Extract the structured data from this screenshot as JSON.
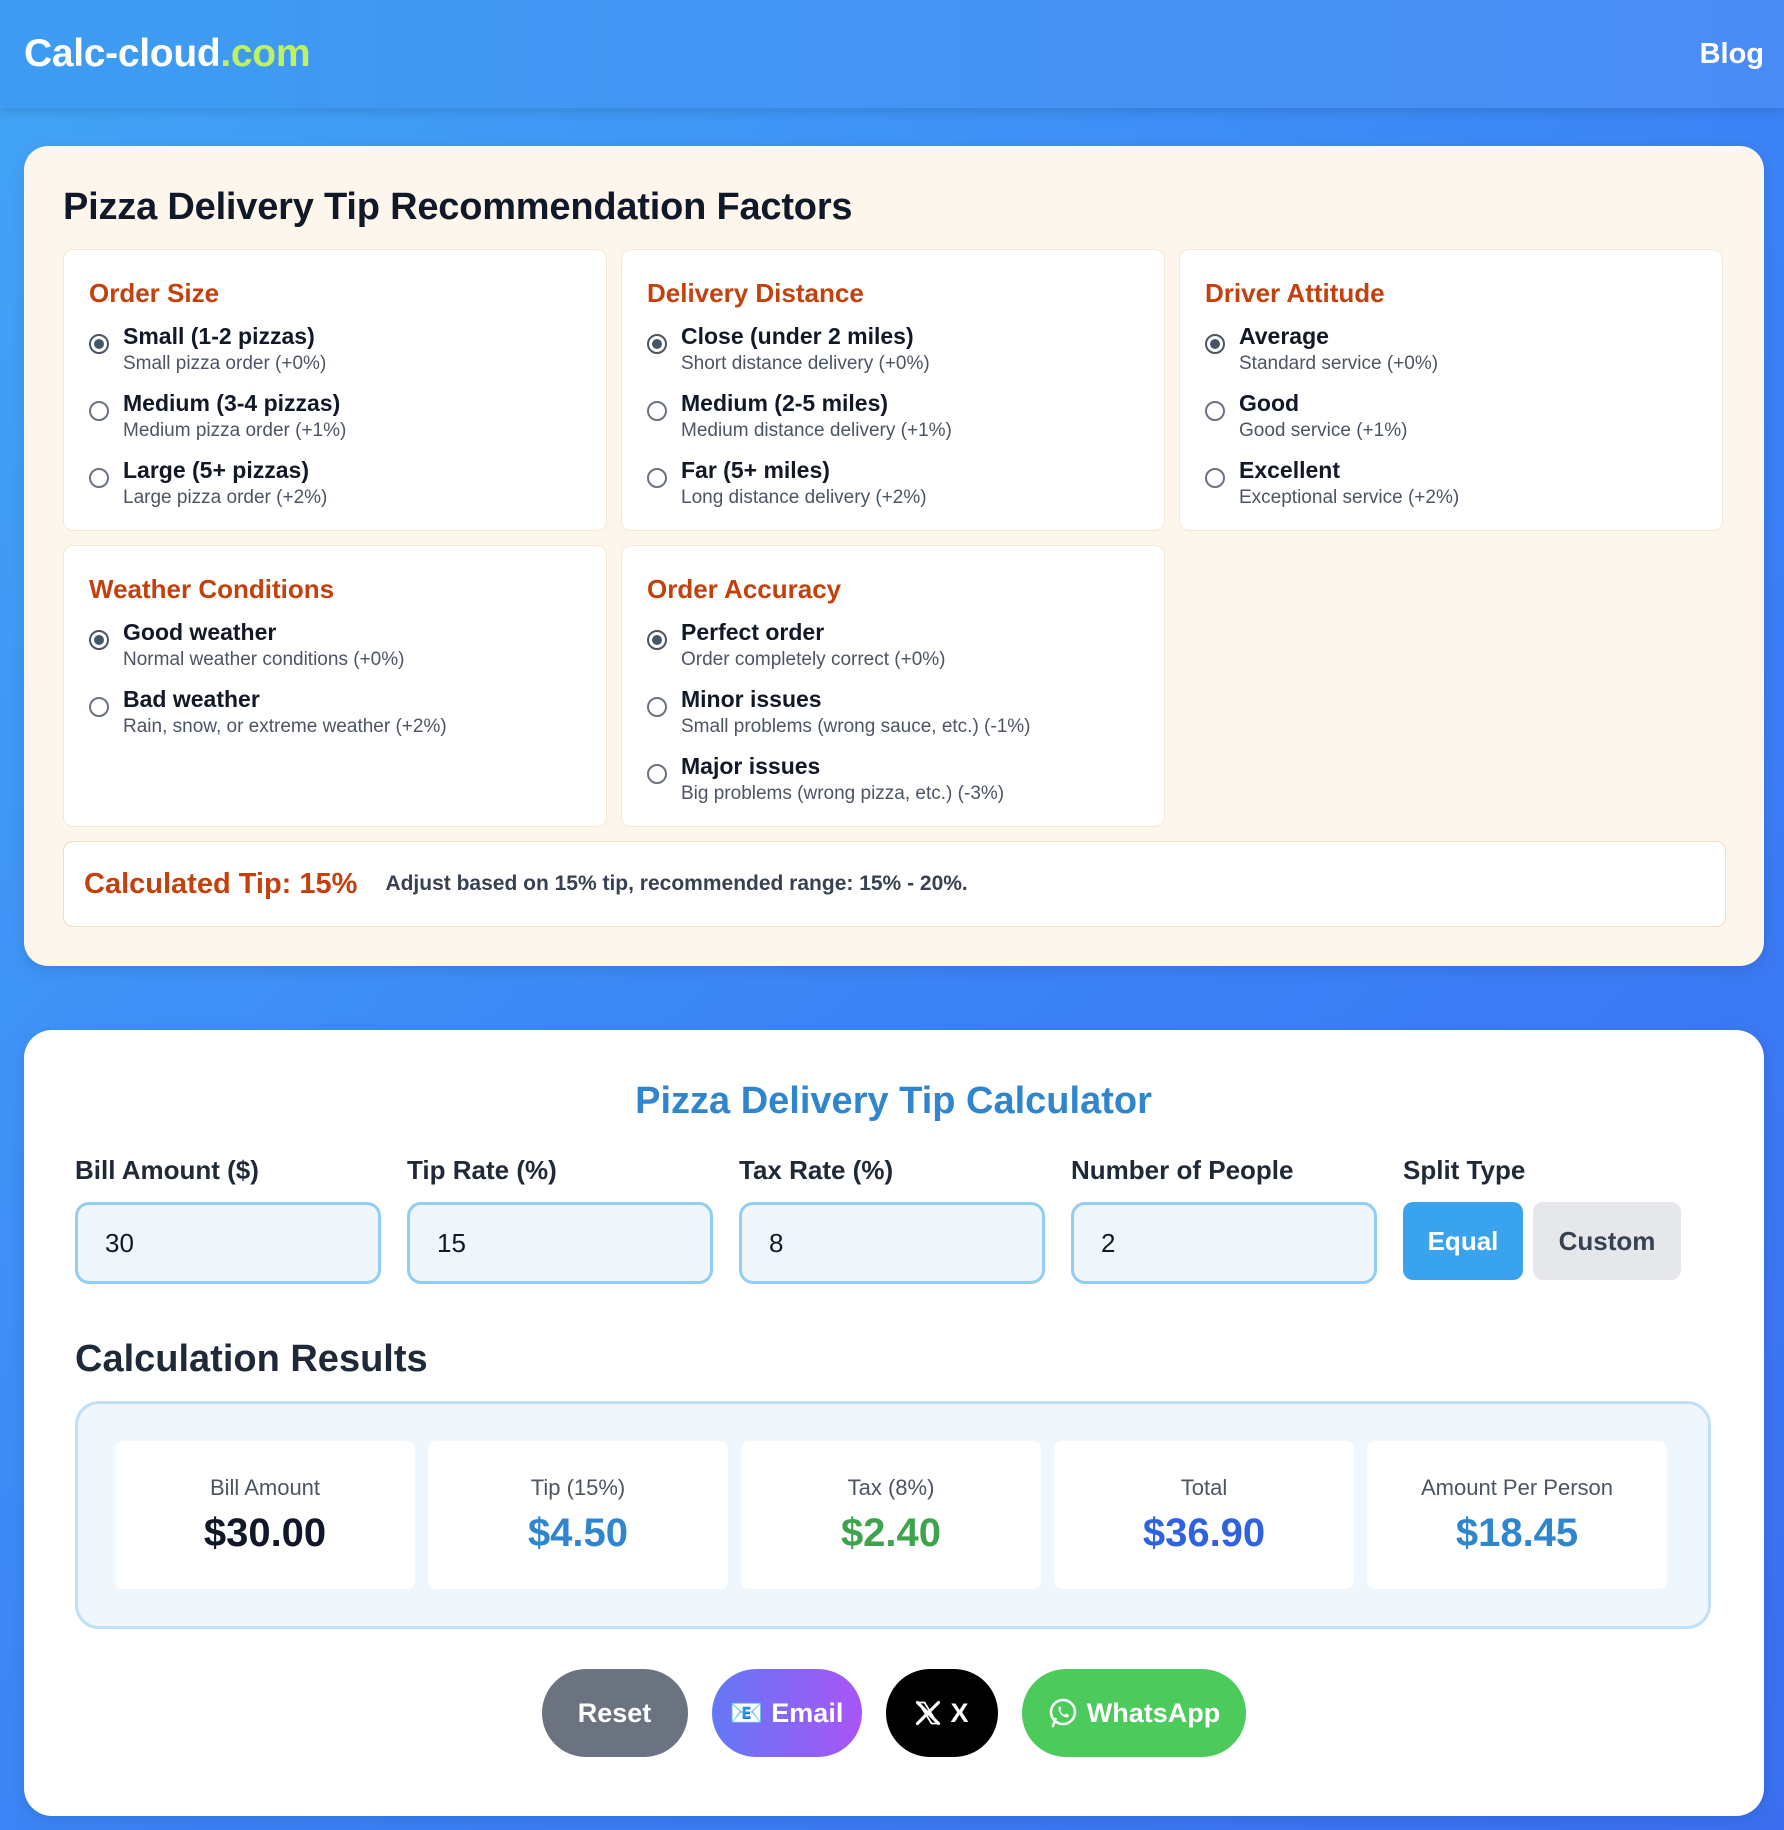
{
  "header": {
    "logo_main": "Calc-cloud",
    "logo_domain": ".com",
    "nav_blog": "Blog"
  },
  "factors": {
    "title": "Pizza Delivery Tip Recommendation Factors",
    "groups": [
      {
        "title": "Order Size",
        "options": [
          {
            "label": "Small (1-2 pizzas)",
            "desc": "Small pizza order (+0%)",
            "checked": true
          },
          {
            "label": "Medium (3-4 pizzas)",
            "desc": "Medium pizza order (+1%)",
            "checked": false
          },
          {
            "label": "Large (5+ pizzas)",
            "desc": "Large pizza order (+2%)",
            "checked": false
          }
        ]
      },
      {
        "title": "Delivery Distance",
        "options": [
          {
            "label": "Close (under 2 miles)",
            "desc": "Short distance delivery (+0%)",
            "checked": true
          },
          {
            "label": "Medium (2-5 miles)",
            "desc": "Medium distance delivery (+1%)",
            "checked": false
          },
          {
            "label": "Far (5+ miles)",
            "desc": "Long distance delivery (+2%)",
            "checked": false
          }
        ]
      },
      {
        "title": "Driver Attitude",
        "options": [
          {
            "label": "Average",
            "desc": "Standard service (+0%)",
            "checked": true
          },
          {
            "label": "Good",
            "desc": "Good service (+1%)",
            "checked": false
          },
          {
            "label": "Excellent",
            "desc": "Exceptional service (+2%)",
            "checked": false
          }
        ]
      },
      {
        "title": "Weather Conditions",
        "options": [
          {
            "label": "Good weather",
            "desc": "Normal weather conditions (+0%)",
            "checked": true
          },
          {
            "label": "Bad weather",
            "desc": "Rain, snow, or extreme weather (+2%)",
            "checked": false
          }
        ]
      },
      {
        "title": "Order Accuracy",
        "options": [
          {
            "label": "Perfect order",
            "desc": "Order completely correct (+0%)",
            "checked": true
          },
          {
            "label": "Minor issues",
            "desc": "Small problems (wrong sauce, etc.) (-1%)",
            "checked": false
          },
          {
            "label": "Major issues",
            "desc": "Big problems (wrong pizza, etc.) (-3%)",
            "checked": false
          }
        ]
      }
    ],
    "calculated_tip": "Calculated Tip: 15%",
    "calculated_note": "Adjust based on 15% tip, recommended range: 15% - 20%."
  },
  "calculator": {
    "title": "Pizza Delivery Tip Calculator",
    "fields": {
      "bill": {
        "label": "Bill Amount ($)",
        "value": "30"
      },
      "tip": {
        "label": "Tip Rate (%)",
        "value": "15"
      },
      "tax": {
        "label": "Tax Rate (%)",
        "value": "8"
      },
      "people": {
        "label": "Number of People",
        "value": "2"
      }
    },
    "split": {
      "label": "Split Type",
      "equal": "Equal",
      "custom": "Custom",
      "selected": "Equal"
    },
    "results_title": "Calculation Results",
    "results": [
      {
        "label": "Bill Amount",
        "value": "$30.00"
      },
      {
        "label": "Tip (15%)",
        "value": "$4.50"
      },
      {
        "label": "Tax (8%)",
        "value": "$2.40"
      },
      {
        "label": "Total",
        "value": "$36.90"
      },
      {
        "label": "Amount Per Person",
        "value": "$18.45"
      }
    ],
    "actions": {
      "reset": "Reset",
      "email": "Email",
      "email_icon": "📧",
      "x": "X",
      "whatsapp": "WhatsApp"
    }
  },
  "colors": {
    "accent_blue": "#2f86cf",
    "factor_title": "#c2410c",
    "logo_domain": "#bef264",
    "tax_green": "#3ea34d",
    "total_indigo": "#2f62e0"
  }
}
